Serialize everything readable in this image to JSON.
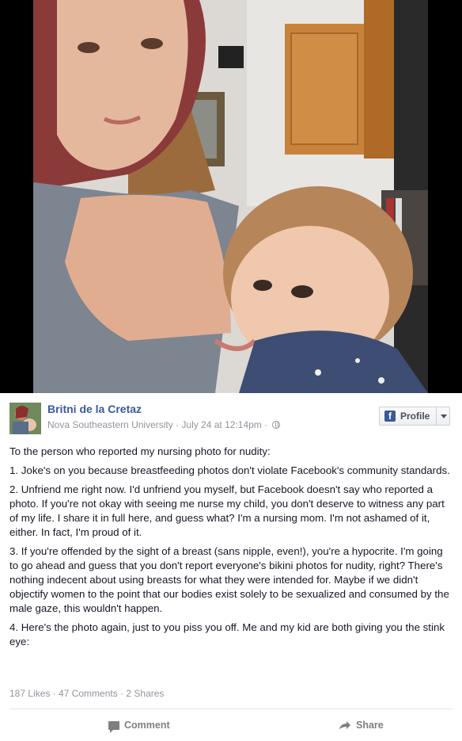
{
  "photo": {
    "description_icon": "photo"
  },
  "post": {
    "author_name": "Britni de la Cretaz",
    "author_meta": "Nova Southeastern University · July 24 at 12:14pm ·",
    "profile_button_label": "Profile",
    "paragraphs": [
      "To the person who reported my nursing photo for nudity:",
      "1. Joke's on you because breastfeeding photos don't violate Facebook's community standards.",
      "2. Unfriend me right now. I'd unfriend you myself, but Facebook doesn't say who reported a photo. If you're not okay with seeing me nurse my child, you don't deserve to witness any part of my life. I share it in full here, and guess what? I'm a nursing mom. I'm not ashamed of it, either. In fact, I'm proud of it.",
      "3. If you're offended by the sight of a breast (sans nipple, even!), you're a hypocrite. I'm going to go ahead and guess that you don't report everyone's bikini photos for nudity, right? There's nothing indecent about using breasts for what they were intended for. Maybe if we didn't objectify women to the point that our bodies exist solely to be sexualized and consumed by the male gaze, this wouldn't happen.",
      "4. Here's the photo again, just to you piss you off. Me and my kid are both giving you the stink eye:"
    ],
    "stats": "187 Likes · 47 Comments · 2 Shares",
    "comment_label": "Comment",
    "share_label": "Share"
  },
  "colors": {
    "link_blue": "#3b5998",
    "meta_gray": "#90949c",
    "action_gray": "#7f7f7f"
  }
}
